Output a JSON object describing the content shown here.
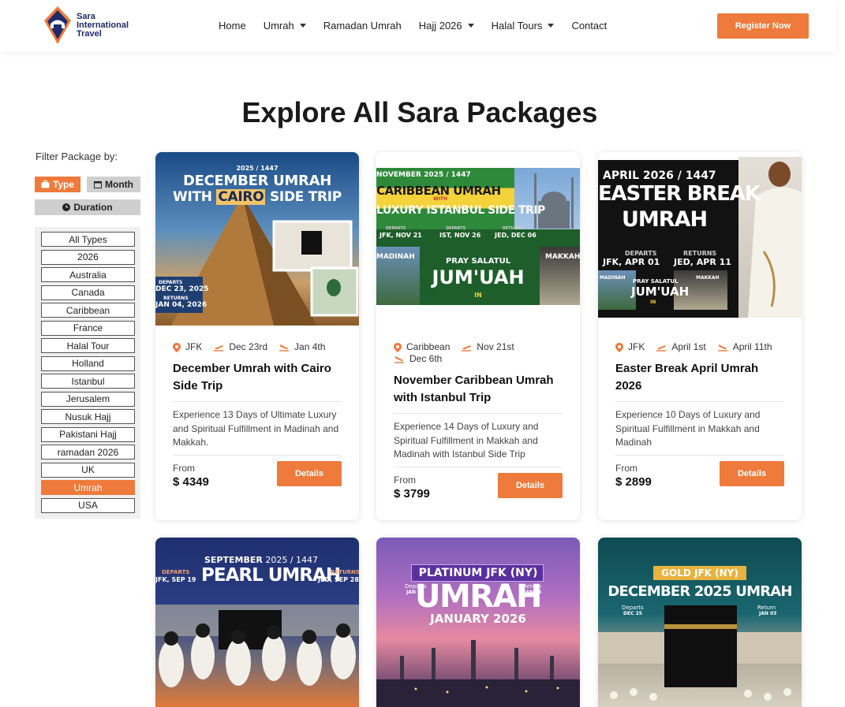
{
  "brand": {
    "line1": "Sara",
    "line2": "International",
    "line3": "Travel"
  },
  "nav": {
    "items": [
      {
        "label": "Home",
        "dropdown": false
      },
      {
        "label": "Umrah",
        "dropdown": true
      },
      {
        "label": "Ramadan Umrah",
        "dropdown": false
      },
      {
        "label": "Hajj 2026",
        "dropdown": true
      },
      {
        "label": "Halal Tours",
        "dropdown": true
      },
      {
        "label": "Contact",
        "dropdown": false
      }
    ],
    "register_label": "Register Now"
  },
  "page_title": "Explore All Sara Packages",
  "filter": {
    "label": "Filter Package by:",
    "tabs": {
      "type": "Type",
      "month": "Month",
      "duration": "Duration"
    },
    "types": [
      "All Types",
      "2026",
      "Australia",
      "Canada",
      "Caribbean",
      "France",
      "Halal Tour",
      "Holland",
      "Istanbul",
      "Jerusalem",
      "Nusuk Hajj",
      "Pakistani Hajj",
      "ramadan 2026",
      "UK",
      "Umrah",
      "USA"
    ],
    "active_type": "Umrah"
  },
  "cards": [
    {
      "image": {
        "top": "2025 / 1447",
        "line1": "DECEMBER UMRAH",
        "line2a": "WITH ",
        "line2b": "CAIRO",
        "line2c": " SIDE TRIP",
        "departs": "DEPARTS",
        "depart_date": "DEC 23, 2025",
        "returns": "RETURNS",
        "return_date": "JAN 04, 2026"
      },
      "location": "JFK",
      "depart": "Dec 23rd",
      "return": "Jan 4th",
      "title": "December Umrah with Cairo Side Trip",
      "desc": "Experience 13 Days of Ultimate Luxury and Spiritual Fulfillment in Madinah and Makkah.",
      "from": "From",
      "price": "$ 4349",
      "details": "Details"
    },
    {
      "image": {
        "top": "NOVEMBER 2025 / 1447",
        "line1": "CARIBBEAN UMRAH",
        "with": "WITH",
        "line2": "LUXURY ISTANBUL SIDE TRIP",
        "d1l": "DEPARTS",
        "d1": "JFK, NOV 21",
        "d2l": "DEPARTS",
        "d2": "IST, NOV 26",
        "d3l": "RETURNS",
        "d3": "JED, DEC 06",
        "madinah": "MADINAH",
        "makkah": "MAKKAH",
        "pray": "PRAY SALATUL",
        "jumuah": "JUM'UAH",
        "in": "IN"
      },
      "location": "Caribbean",
      "depart": "Nov 21st",
      "return": "Dec 6th",
      "title": "November Caribbean Umrah with Istanbul Trip",
      "desc": "Experience 14 Days of Luxury and Spiritual Fulfillment in Makkah and Madinah with Istanbul Side Trip",
      "from": "From",
      "price": "$ 3799",
      "details": "Details"
    },
    {
      "image": {
        "top": "APRIL 2026 / 1447",
        "line1": "EASTER BREAK",
        "line2": "UMRAH",
        "dl": "DEPARTS",
        "d": "JFK, APR 01",
        "rl": "RETURNS",
        "r": "JED, APR 11",
        "madinah": "MADINAH",
        "makkah": "MAKKAH",
        "pray": "PRAY SALATUL",
        "jumuah": "JUM'UAH",
        "in": "IN"
      },
      "location": "JFK",
      "depart": "April 1st",
      "return": "April 11th",
      "title": "Easter Break April Umrah 2026",
      "desc": "Experience 10 Days of Luxury and Spiritual Fulfillment in Makkah and Madinah",
      "from": "From",
      "price": "$ 2899",
      "details": "Details"
    },
    {
      "image": {
        "top1": "SEPTEMBER",
        "top2": " 2025 / 1447",
        "title": "PEARL UMRAH",
        "dl": "DEPARTS",
        "d": "JFK, SEP 19",
        "rl": "RETURNS",
        "r": "JED, SEP 28"
      }
    },
    {
      "image": {
        "badge": "PLATINUM JFK (NY)",
        "title": "UMRAH",
        "sub": "JANUARY 2026",
        "dl": "Departs",
        "d": "JAN 16",
        "rl": "Return",
        "r": "JAN 25"
      }
    },
    {
      "image": {
        "badge": "GOLD JFK (NY)",
        "title": "DECEMBER 2025 UMRAH",
        "dl": "Departs",
        "d": "DEC 25",
        "rl": "Return",
        "r": "JAN 03"
      }
    }
  ]
}
